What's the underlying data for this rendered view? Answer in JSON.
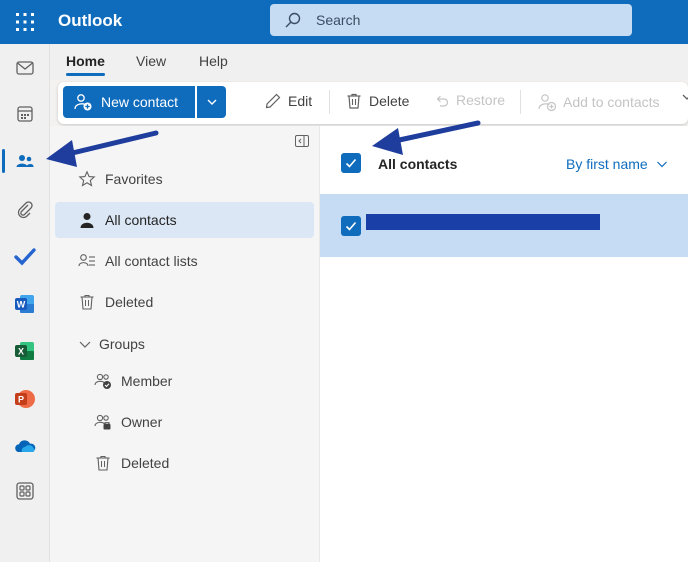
{
  "app": {
    "title": "Outlook",
    "search_placeholder": "Search",
    "brand_color": "#0f6cbd"
  },
  "rail": {
    "items": [
      {
        "icon": "mail-icon"
      },
      {
        "icon": "calendar-icon"
      },
      {
        "icon": "people-icon",
        "active": true
      },
      {
        "icon": "attachment-icon"
      },
      {
        "icon": "todo-icon"
      },
      {
        "icon": "word-icon"
      },
      {
        "icon": "excel-icon"
      },
      {
        "icon": "powerpoint-icon"
      },
      {
        "icon": "onedrive-icon"
      },
      {
        "icon": "more-apps-icon"
      }
    ]
  },
  "tabs": [
    {
      "label": "Home",
      "active": true
    },
    {
      "label": "View"
    },
    {
      "label": "Help"
    }
  ],
  "toolbar": {
    "new_contact": "New contact",
    "edit": "Edit",
    "delete": "Delete",
    "restore": "Restore",
    "add_to_contacts": "Add to contacts"
  },
  "nav": {
    "favorites": "Favorites",
    "all_contacts": "All contacts",
    "all_contact_lists": "All contact lists",
    "deleted": "Deleted",
    "groups": "Groups",
    "groups_member": "Member",
    "groups_owner": "Owner",
    "groups_deleted": "Deleted"
  },
  "list": {
    "title": "All contacts",
    "sort_label": "By first name",
    "select_all_checked": true,
    "rows": [
      {
        "name_redacted": true,
        "checked": true
      }
    ]
  },
  "annotation_color": "#1f3d9c"
}
